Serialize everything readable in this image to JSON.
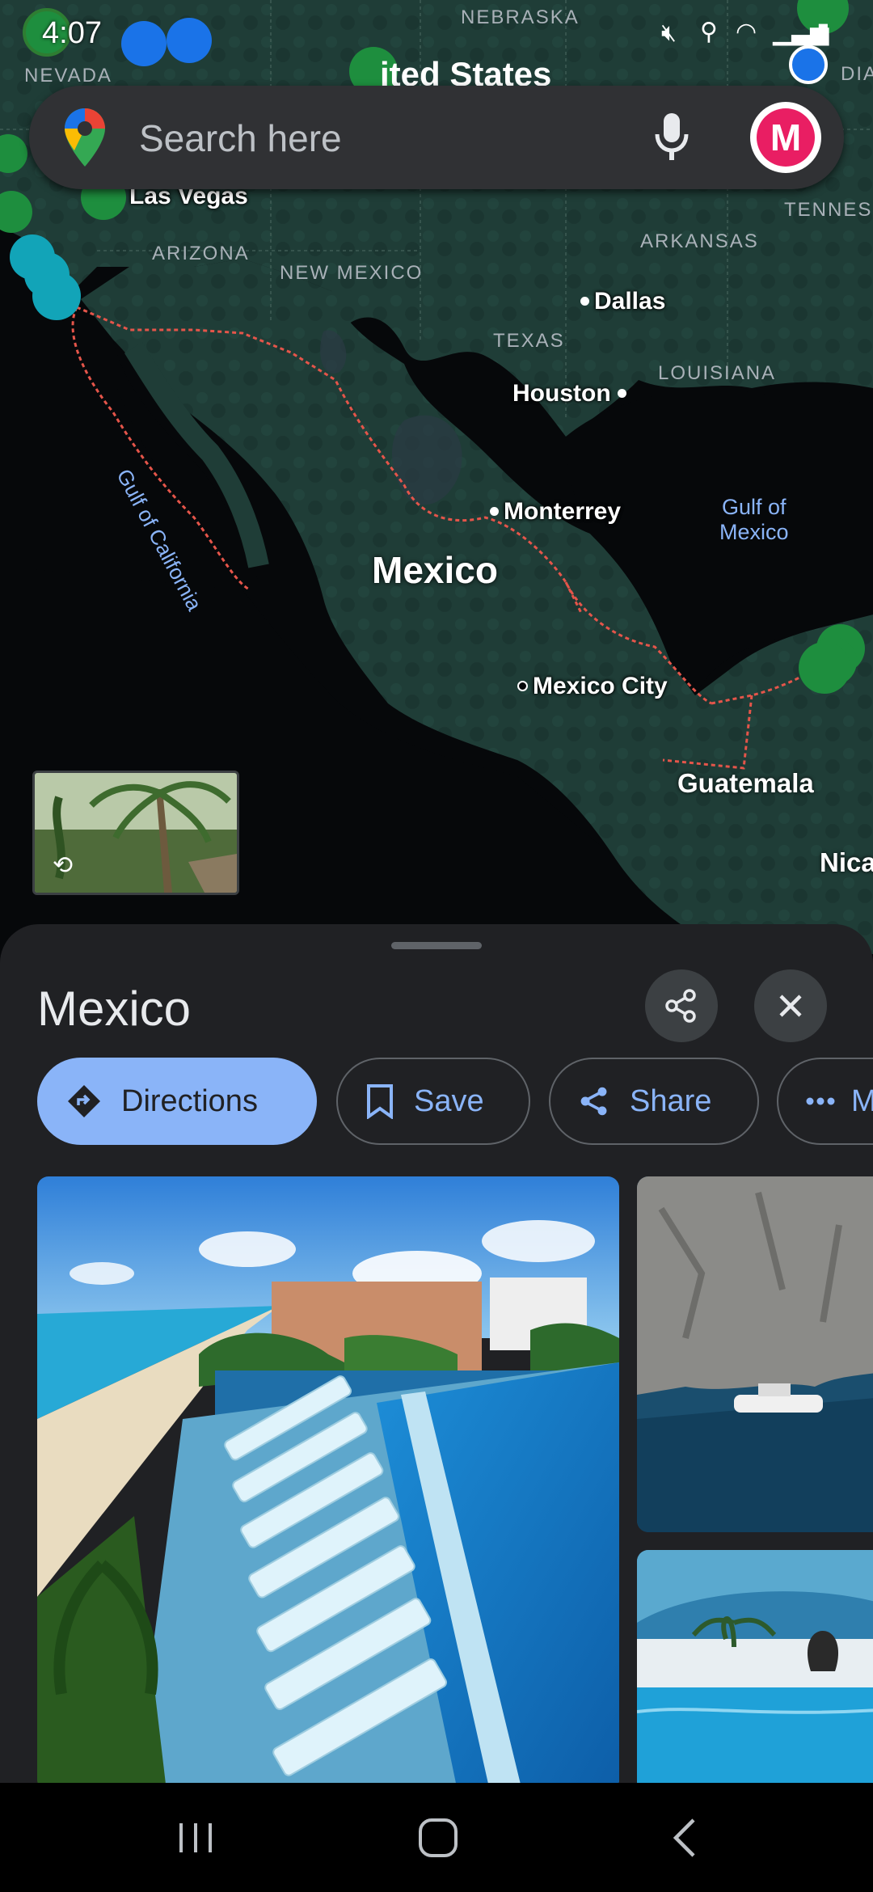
{
  "status_bar": {
    "time": "4:07"
  },
  "search": {
    "placeholder": "Search here",
    "avatar_letter": "M"
  },
  "map": {
    "labels": {
      "nebraska": "NEBRASKA",
      "nevada": "NEVADA",
      "united_states": "ited States",
      "india": "DIA",
      "las_vegas": "Las Vegas",
      "arizona": "ARIZONA",
      "new_mexico": "NEW MEXICO",
      "arkansas": "ARKANSAS",
      "tennessee": "TENNES",
      "dallas": "Dallas",
      "texas": "TEXAS",
      "houston": "Houston",
      "louisiana": "LOUISIANA",
      "gulf_of_california": "Gulf of California",
      "gulf_of_mexico_1": "Gulf of",
      "gulf_of_mexico_2": "Mexico",
      "monterrey": "Monterrey",
      "mexico": "Mexico",
      "mexico_city": "Mexico City",
      "guatemala": "Guatemala",
      "nicaragua": "Nica"
    }
  },
  "place_sheet": {
    "title": "Mexico",
    "actions": [
      {
        "label": "Directions",
        "icon": "directions-icon"
      },
      {
        "label": "Save",
        "icon": "bookmark-icon"
      },
      {
        "label": "Share",
        "icon": "share-icon"
      },
      {
        "label": "M",
        "icon": "more-icon"
      }
    ]
  },
  "colors": {
    "accent": "#8ab4f8",
    "sheet_bg": "#202124",
    "land": "#1d3b35",
    "border": "#e5554a"
  }
}
